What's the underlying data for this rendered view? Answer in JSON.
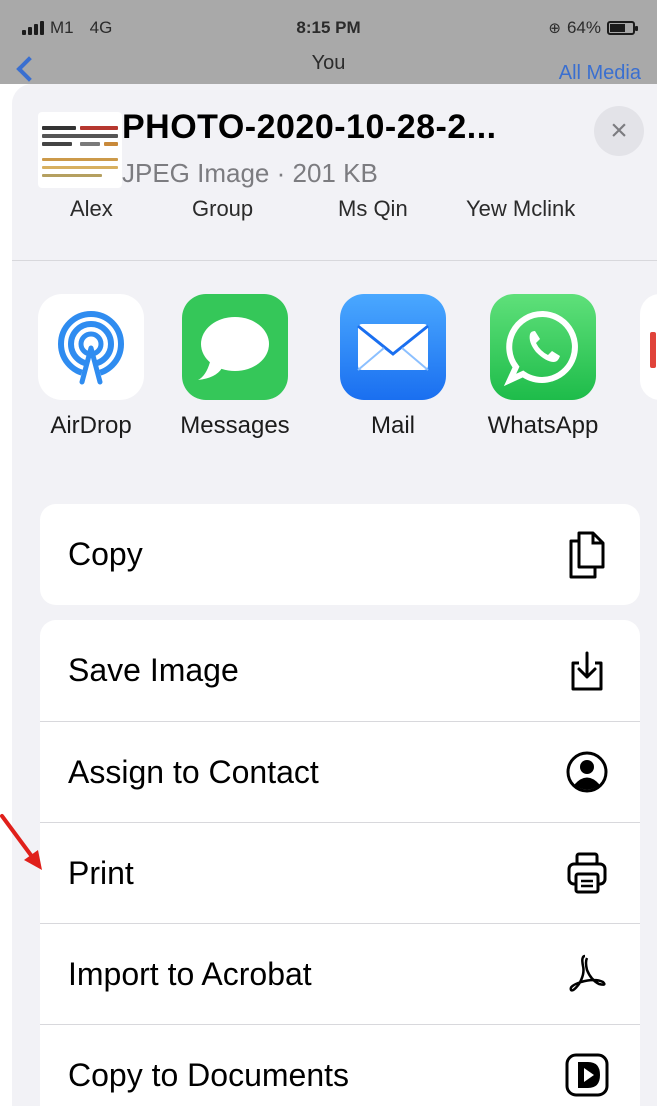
{
  "status_bar": {
    "carrier": "M1",
    "network": "4G",
    "time": "8:15 PM",
    "battery_text": "64%"
  },
  "nav": {
    "title": "You",
    "right_label": "All Media"
  },
  "share_sheet": {
    "file_name": "PHOTO-2020-10-28-2...",
    "file_meta": "JPEG Image · 201 KB",
    "close_glyph": "×"
  },
  "people": [
    "Alex",
    "Group",
    "Ms Qin",
    "Yew Mclink"
  ],
  "apps": [
    {
      "label": "AirDrop",
      "icon": "airdrop-icon"
    },
    {
      "label": "Messages",
      "icon": "messages-icon"
    },
    {
      "label": "Mail",
      "icon": "mail-icon"
    },
    {
      "label": "WhatsApp",
      "icon": "whatsapp-icon"
    }
  ],
  "actions_group1": [
    {
      "label": "Copy",
      "icon": "copy-icon"
    }
  ],
  "actions_group2": [
    {
      "label": "Save Image",
      "icon": "save-image-icon"
    },
    {
      "label": "Assign to Contact",
      "icon": "contact-icon"
    },
    {
      "label": "Print",
      "icon": "print-icon"
    },
    {
      "label": "Import to Acrobat",
      "icon": "acrobat-icon"
    },
    {
      "label": "Copy to Documents",
      "icon": "documents-icon"
    }
  ],
  "colors": {
    "accent": "#3a6fd0",
    "annotation_arrow": "#e0201b",
    "sheet_bg": "#f2f2f6"
  }
}
